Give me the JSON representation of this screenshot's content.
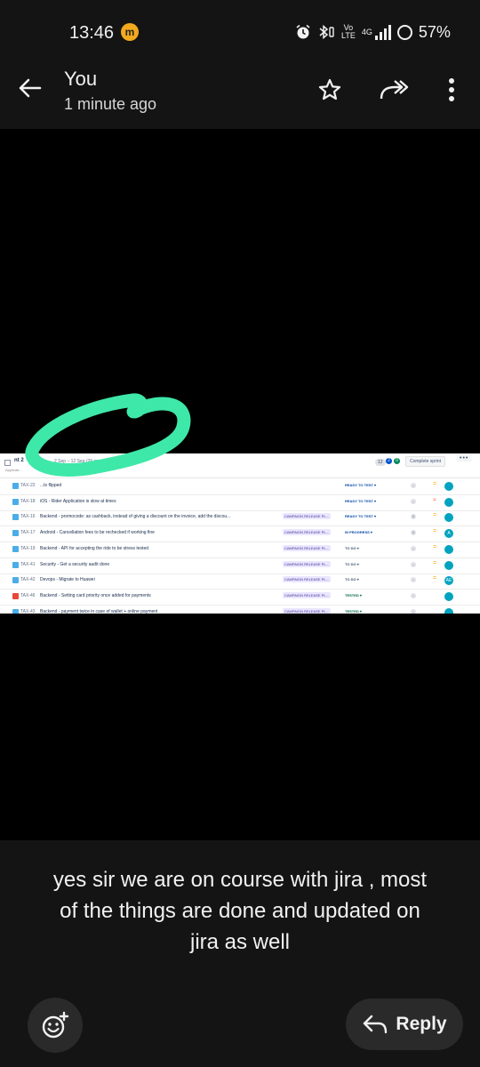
{
  "status_bar": {
    "time": "13:46",
    "notification_badge": "m",
    "volte_top": "Vo",
    "volte_bottom": "LTE",
    "network": "4G",
    "battery": "57%",
    "icons": [
      "alarm-icon",
      "bluetooth-icon",
      "volte-icon",
      "signal-icon",
      "battery-icon"
    ]
  },
  "header": {
    "title": "You",
    "subtitle": "1 minute ago",
    "icons": [
      "back-arrow-icon",
      "star-icon",
      "forward-icon",
      "more-vert-icon"
    ]
  },
  "image": {
    "sprint": {
      "name": "nt 2",
      "dates": "2 Sep – 12 Sep",
      "issue_count": "(26 issues)",
      "sub": "Applicati...",
      "sub_right": "ent Santy",
      "count": "12",
      "badge_blue": "2",
      "badge_green": "0",
      "complete_button": "Complete sprint",
      "more": "•••"
    },
    "rows": [
      {
        "key": "TAX-22",
        "summary": "...ts flipped",
        "epic": "",
        "status": "READY TO TEST ▾",
        "est": "-",
        "priority": "=",
        "avatar": "",
        "type": "story"
      },
      {
        "key": "TAX-18",
        "summary": "iOS - Rider Application is slow at times",
        "epic": "",
        "status": "READY TO TEST ▾",
        "est": "-",
        "priority": "≈",
        "avatar": "",
        "type": "story"
      },
      {
        "key": "TAX-16",
        "summary": "Backend - promocode: as cashback, instead of giving a discount on the invoice, add the discou...",
        "epic": "CAMPAIGN RELEASE PL...",
        "status": "READY TO TEST ▾",
        "est": "1",
        "priority": "=",
        "avatar": "",
        "type": "story"
      },
      {
        "key": "TAX-17",
        "summary": "Android - Cancellation fees to be rechecked if working fine",
        "epic": "CAMPAIGN RELEASE PL...",
        "status": "IN PROGRESS ▾",
        "est": "1",
        "priority": "=",
        "avatar": "A",
        "type": "story"
      },
      {
        "key": "TAX-19",
        "summary": "Backend - API for accepting the ride to be stress tested",
        "epic": "CAMPAIGN RELEASE PL...",
        "status": "TO DO ▾",
        "est": "-",
        "priority": "=",
        "avatar": "",
        "type": "story"
      },
      {
        "key": "TAX-41",
        "summary": "Security - Get a security audit done",
        "epic": "CAMPAIGN RELEASE PL...",
        "status": "TO DO ▾",
        "est": "-",
        "priority": "=",
        "avatar": "",
        "type": "story"
      },
      {
        "key": "TAX-42",
        "summary": "Devops - Migrate to Huawei",
        "epic": "CAMPAIGN RELEASE PL...",
        "status": "TO DO ▾",
        "est": "-",
        "priority": "=",
        "avatar": "AE",
        "type": "story"
      },
      {
        "key": "TAX-46",
        "summary": "Backend - Setting card priority once added for payments",
        "epic": "CAMPAIGN RELEASE PL...",
        "status": "TESTED ▾",
        "est": "-",
        "priority": "",
        "avatar": "",
        "type": "bug"
      },
      {
        "key": "TAX-43",
        "summary": "Backend - payment twice in case of wallet + online payment",
        "epic": "CAMPAIGN RELEASE PL...",
        "status": "TESTED ▾",
        "est": "-",
        "priority": "",
        "avatar": "",
        "type": "story"
      }
    ]
  },
  "caption": "yes sir we are on course with jira , most of the things are done and updated on jira as well",
  "actions": {
    "reply_label": "Reply",
    "icons": [
      "emoji-react-icon",
      "reply-icon"
    ]
  },
  "colors": {
    "background": "#000000",
    "bar": "#141414",
    "button": "#2a2a2a",
    "annotation": "#3ee8a8",
    "badge": "#f3a91d"
  }
}
